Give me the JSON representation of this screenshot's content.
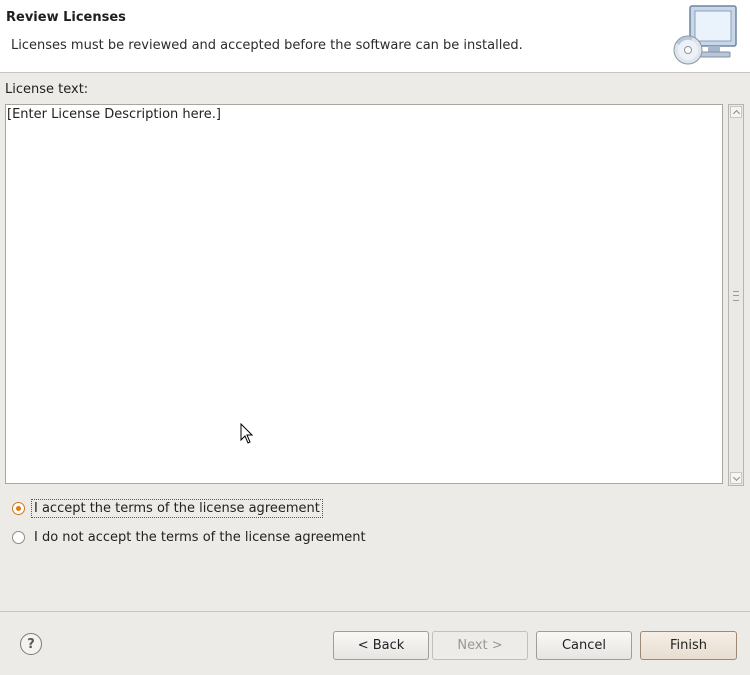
{
  "header": {
    "title": "Review Licenses",
    "description": "Licenses must be reviewed and accepted before the software can be installed.",
    "icon": "monitor-cd-icon"
  },
  "license": {
    "label": "License text:",
    "text": "[Enter License Description here.]"
  },
  "options": {
    "accept_label": "I accept the terms of the license agreement",
    "decline_label": "I do not accept the terms of the license agreement",
    "selected": "accept"
  },
  "buttons": {
    "help": "?",
    "back": "< Back",
    "next": "Next >",
    "cancel": "Cancel",
    "finish": "Finish"
  },
  "colors": {
    "radio_accent": "#e07a10",
    "background": "#edebe8"
  }
}
